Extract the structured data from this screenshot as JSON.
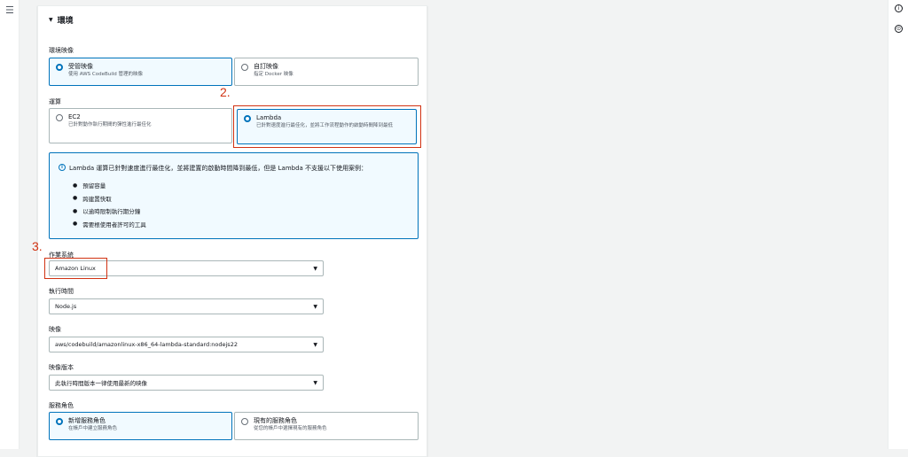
{
  "nav": {
    "menu_icon": "☰"
  },
  "right_rail": {
    "info_icon": "i",
    "settings_icon": "⊙"
  },
  "section": {
    "title": "環境",
    "caret": "▼"
  },
  "image": {
    "label": "環境映像",
    "options": [
      {
        "title": "受管映像",
        "desc": "使用 AWS CodeBuild 管理的映像",
        "selected": true
      },
      {
        "title": "自訂映像",
        "desc": "指定 Docker 映像",
        "selected": false
      }
    ]
  },
  "compute": {
    "label": "運算",
    "options": [
      {
        "title": "EC2",
        "desc": "已針對動作執行期間的彈性進行最佳化",
        "selected": false
      },
      {
        "title": "Lambda",
        "desc": "已針對速度進行最佳化，並將工作流程動作的啟動時間降到最低",
        "selected": true
      }
    ]
  },
  "annotations": {
    "step2": "2.",
    "step3": "3."
  },
  "info": {
    "icon": "i",
    "text": "Lambda 運算已針對速度進行最佳化，並將建置的啟動時間降到最低，但是 Lambda 不支援以下使用案例：",
    "items": [
      "預留容量",
      "跨建置快取",
      "以逾時限制執行期分鐘",
      "需要根使用者許可的工具"
    ]
  },
  "os": {
    "label": "作業系統",
    "value": "Amazon Linux"
  },
  "runtime": {
    "label": "執行時間",
    "value": "Node.js"
  },
  "image_uri": {
    "label": "映像",
    "value": "aws/codebuild/amazonlinux-x86_64-lambda-standard:nodejs22"
  },
  "image_version": {
    "label": "映像版本",
    "value": "此執行時間版本一律使用最新的映像"
  },
  "service_role": {
    "label": "服務角色",
    "options": [
      {
        "title": "新增服務角色",
        "desc": "在帳戶中建立服務角色",
        "selected": true
      },
      {
        "title": "現有的服務角色",
        "desc": "從您的帳戶中選擇現有的服務角色",
        "selected": false
      }
    ]
  },
  "dropdown_arrow": "▼"
}
